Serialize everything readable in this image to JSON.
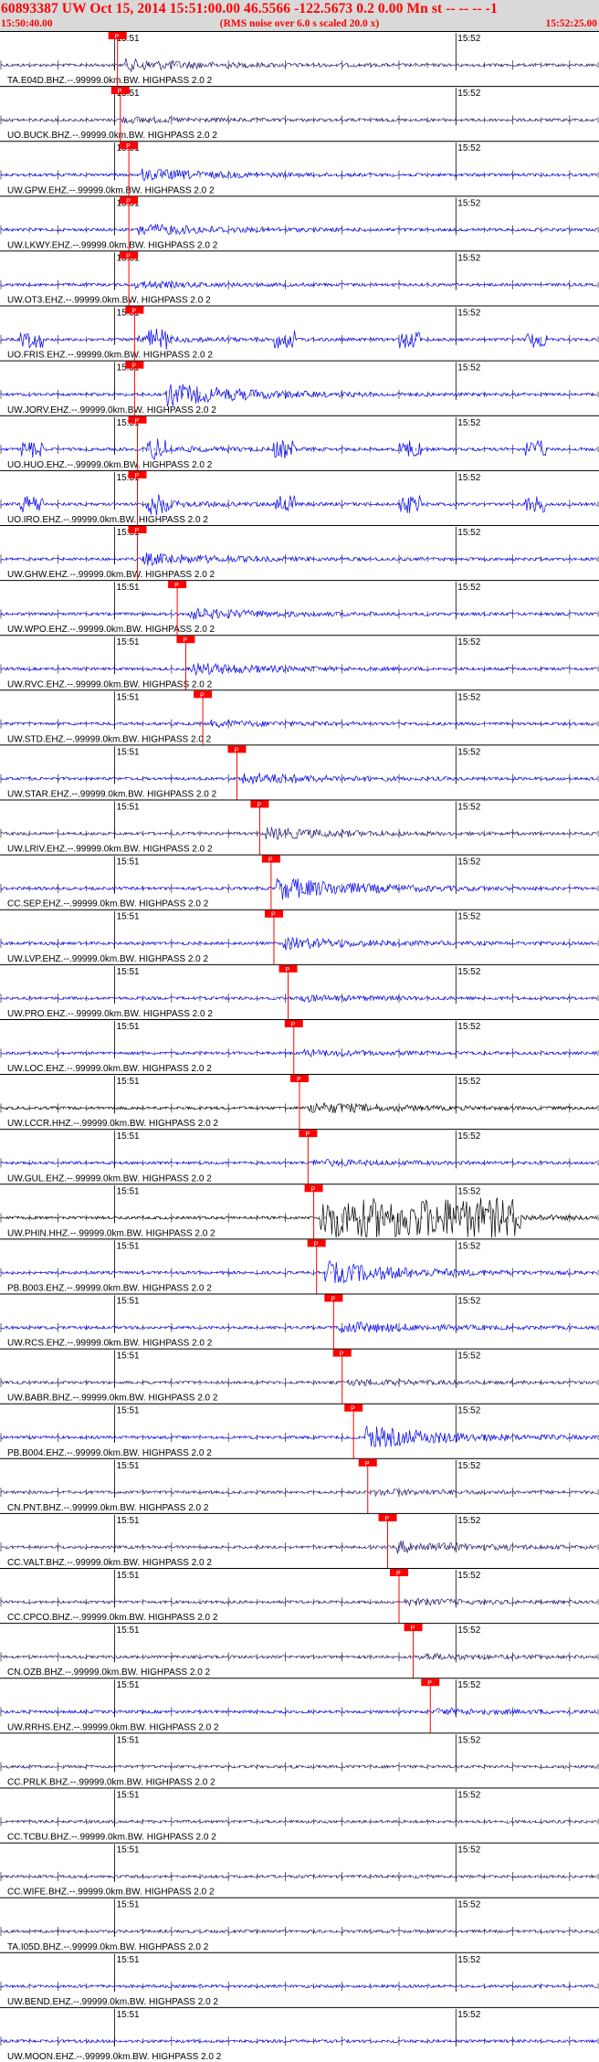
{
  "header": {
    "title": "60893387 UW Oct 15, 2014 15:51:00.00   46.5566 -122.5673  0.2 0.00 Mn st -- -- --  -1",
    "subtitle": "(RMS noise over 6.0 s scaled 20.0 x)",
    "time_start": "15:50:40.00",
    "time_end": "15:52:25.00"
  },
  "colors": {
    "header_bg": "#d9d9d9",
    "header_text": "#ff0000",
    "trace_blue": "#0000ff",
    "trace_purple": "#2a1a7a",
    "trace_black": "#000000",
    "pick_red": "#ff0000"
  },
  "chart_data": {
    "type": "seismogram",
    "time_window": [
      "15:50:40.00",
      "15:52:25.00"
    ],
    "minute_labels": [
      "15:51",
      "15:52"
    ],
    "pick_label": "P",
    "traces": [
      {
        "label": "TA.E04D.BHZ.--.99999.0km.BW. HIGHPASS  2.0  2",
        "color": "purple",
        "pick_minute": "15:51",
        "pick_sec": 0.5,
        "event_sec": 1.5,
        "amplitude": "medium"
      },
      {
        "label": "UO.BUCK.BHZ.--.99999.0km.BW. HIGHPASS  2.0  2",
        "color": "purple",
        "pick_minute": "15:51",
        "pick_sec": 1.0,
        "event_sec": 0.5,
        "amplitude": "low"
      },
      {
        "label": "UW.GPW.EHZ.--.99999.0km.BW. HIGHPASS  2.0  2",
        "color": "blue",
        "pick_minute": "15:51",
        "pick_sec": 2.5,
        "event_sec": 4.5,
        "amplitude": "medium"
      },
      {
        "label": "UW.LKWY.EHZ.--.99999.0km.BW. HIGHPASS  2.0  2",
        "color": "blue",
        "pick_minute": "15:51",
        "pick_sec": 2.5,
        "event_sec": 4.0,
        "amplitude": "medium"
      },
      {
        "label": "UW.OT3.EHZ.--.99999.0km.BW. HIGHPASS  2.0  2",
        "color": "blue",
        "pick_minute": "15:51",
        "pick_sec": 2.5,
        "event_sec": 3.5,
        "amplitude": "low"
      },
      {
        "label": "UO.FRIS.EHZ.--.99999.0km.BW. HIGHPASS  2.0  2",
        "color": "blue",
        "pick_minute": "15:51",
        "pick_sec": 3.5,
        "event_sec": 4.0,
        "amplitude": "bursts"
      },
      {
        "label": "UW.JORV.EHZ.--.99999.0km.BW. HIGHPASS  2.0  2",
        "color": "blue",
        "pick_minute": "15:51",
        "pick_sec": 3.5,
        "event_sec": 9.0,
        "amplitude": "high"
      },
      {
        "label": "UO.HUO.EHZ.--.99999.0km.BW. HIGHPASS  2.0  2",
        "color": "blue",
        "pick_minute": "15:51",
        "pick_sec": 4.0,
        "event_sec": 6.0,
        "amplitude": "bursts"
      },
      {
        "label": "UO.IRO.EHZ.--.99999.0km.BW. HIGHPASS  2.0  2",
        "color": "blue",
        "pick_minute": "15:51",
        "pick_sec": 4.0,
        "event_sec": 6.0,
        "amplitude": "bursts"
      },
      {
        "label": "UW.GHW.EHZ.--.99999.0km.BW. HIGHPASS  2.0  2",
        "color": "blue",
        "pick_minute": "15:51",
        "pick_sec": 4.0,
        "event_sec": 5.0,
        "amplitude": "medium"
      },
      {
        "label": "UW.WPO.EHZ.--.99999.0km.BW. HIGHPASS  2.0  2",
        "color": "blue",
        "pick_minute": "15:51",
        "pick_sec": 11.0,
        "event_sec": 12.0,
        "amplitude": "medium"
      },
      {
        "label": "UW.RVC.EHZ.--.99999.0km.BW. HIGHPASS  2.0  2",
        "color": "blue",
        "pick_minute": "15:51",
        "pick_sec": 12.5,
        "event_sec": 13.5,
        "amplitude": "medium"
      },
      {
        "label": "UW.STD.EHZ.--.99999.0km.BW. HIGHPASS  2.0  2",
        "color": "blue",
        "pick_minute": "15:51",
        "pick_sec": 15.5,
        "event_sec": 16.5,
        "amplitude": "low"
      },
      {
        "label": "UW.STAR.EHZ.--.99999.0km.BW. HIGHPASS  2.0  2",
        "color": "blue",
        "pick_minute": "15:51",
        "pick_sec": 21.5,
        "event_sec": 22.5,
        "amplitude": "medium"
      },
      {
        "label": "UW.LRIV.EHZ.--.99999.0km.BW. HIGHPASS  2.0  2",
        "color": "purple",
        "pick_minute": "15:51",
        "pick_sec": 25.5,
        "event_sec": 26.5,
        "amplitude": "medium"
      },
      {
        "label": "CC.SEP.EHZ.--.99999.0km.BW. HIGHPASS  2.0  2",
        "color": "blue",
        "pick_minute": "15:51",
        "pick_sec": 27.5,
        "event_sec": 28.5,
        "amplitude": "high"
      },
      {
        "label": "UW.LVP.EHZ.--.99999.0km.BW. HIGHPASS  2.0  2",
        "color": "blue",
        "pick_minute": "15:51",
        "pick_sec": 28.0,
        "event_sec": 29.5,
        "amplitude": "medium"
      },
      {
        "label": "UW.PRO.EHZ.--.99999.0km.BW. HIGHPASS  2.0  2",
        "color": "blue",
        "pick_minute": "15:51",
        "pick_sec": 30.5,
        "event_sec": 32.0,
        "amplitude": "low"
      },
      {
        "label": "UW.LOC.EHZ.--.99999.0km.BW. HIGHPASS  2.0  2",
        "color": "blue",
        "pick_minute": "15:51",
        "pick_sec": 31.5,
        "event_sec": 33.0,
        "amplitude": "low"
      },
      {
        "label": "UW.LCCR.HHZ.--.99999.0km.BW. HIGHPASS  2.0  2",
        "color": "black",
        "pick_minute": "15:51",
        "pick_sec": 32.5,
        "event_sec": 34.0,
        "amplitude": "medium"
      },
      {
        "label": "UW.GUL.EHZ.--.99999.0km.BW. HIGHPASS  2.0  2",
        "color": "blue",
        "pick_minute": "15:51",
        "pick_sec": 34.0,
        "event_sec": 35.0,
        "amplitude": "low"
      },
      {
        "label": "UW.PHIN.HHZ.--.99999.0km.BW. HIGHPASS  2.0  2",
        "color": "black",
        "pick_minute": "15:51",
        "pick_sec": 35.0,
        "event_sec": 36.0,
        "amplitude": "saturated"
      },
      {
        "label": "PB.B003.EHZ.--.99999.0km.BW. HIGHPASS  2.0  2",
        "color": "blue",
        "pick_minute": "15:51",
        "pick_sec": 35.5,
        "event_sec": 37.0,
        "amplitude": "high"
      },
      {
        "label": "UW.RCS.EHZ.--.99999.0km.BW. HIGHPASS  2.0  2",
        "color": "blue",
        "pick_minute": "15:51",
        "pick_sec": 38.5,
        "event_sec": 39.5,
        "amplitude": "medium"
      },
      {
        "label": "UW.BABR.BHZ.--.99999.0km.BW. HIGHPASS  2.0  2",
        "color": "purple",
        "pick_minute": "15:51",
        "pick_sec": 40.0,
        "event_sec": 41.0,
        "amplitude": "low"
      },
      {
        "label": "PB.B004.EHZ.--.99999.0km.BW. HIGHPASS  2.0  2",
        "color": "blue",
        "pick_minute": "15:51",
        "pick_sec": 42.0,
        "event_sec": 44.0,
        "amplitude": "high"
      },
      {
        "label": "CN.PNT.BHZ.--.99999.0km.BW. HIGHPASS  2.0  2",
        "color": "purple",
        "pick_minute": "15:51",
        "pick_sec": 44.5,
        "event_sec": 45.5,
        "amplitude": "low"
      },
      {
        "label": "CC.VALT.BHZ.--.99999.0km.BW. HIGHPASS  2.0  2",
        "color": "purple",
        "pick_minute": "15:51",
        "pick_sec": 48.0,
        "event_sec": 49.5,
        "amplitude": "medium"
      },
      {
        "label": "CC.CPCO.BHZ.--.99999.0km.BW. HIGHPASS  2.0  2",
        "color": "purple",
        "pick_minute": "15:51",
        "pick_sec": 50.0,
        "event_sec": 51.0,
        "amplitude": "low"
      },
      {
        "label": "CN.OZB.BHZ.--.99999.0km.BW. HIGHPASS  2.0  2",
        "color": "purple",
        "pick_minute": "15:51",
        "pick_sec": 52.5,
        "event_sec": 53.5,
        "amplitude": "low"
      },
      {
        "label": "UW.RRHS.EHZ.--.99999.0km.BW. HIGHPASS  2.0  2",
        "color": "blue",
        "pick_minute": "15:51",
        "pick_sec": 55.5,
        "event_sec": 56.5,
        "amplitude": "low"
      },
      {
        "label": "CC.PRLK.BHZ.--.99999.0km.BW. HIGHPASS  2.0  2",
        "color": "purple",
        "pick_minute": "",
        "pick_sec": null,
        "event_sec": null,
        "amplitude": "low"
      },
      {
        "label": "CC.TCBU.BHZ.--.99999.0km.BW. HIGHPASS  2.0  2",
        "color": "purple",
        "pick_minute": "",
        "pick_sec": null,
        "event_sec": null,
        "amplitude": "low"
      },
      {
        "label": "CC.WIFE.BHZ.--.99999.0km.BW. HIGHPASS  2.0  2",
        "color": "purple",
        "pick_minute": "",
        "pick_sec": null,
        "event_sec": null,
        "amplitude": "low"
      },
      {
        "label": "TA.I05D.BHZ.--.99999.0km.BW. HIGHPASS  2.0  2",
        "color": "purple",
        "pick_minute": "",
        "pick_sec": null,
        "event_sec": null,
        "amplitude": "low"
      },
      {
        "label": "UW.BEND.EHZ.--.99999.0km.BW. HIGHPASS  2.0  2",
        "color": "blue",
        "pick_minute": "",
        "pick_sec": null,
        "event_sec": null,
        "amplitude": "low"
      },
      {
        "label": "UW.MOON.EHZ.--.99999.0km.BW. HIGHPASS  2.0  2",
        "color": "blue",
        "pick_minute": "",
        "pick_sec": null,
        "event_sec": null,
        "amplitude": "low"
      }
    ]
  }
}
